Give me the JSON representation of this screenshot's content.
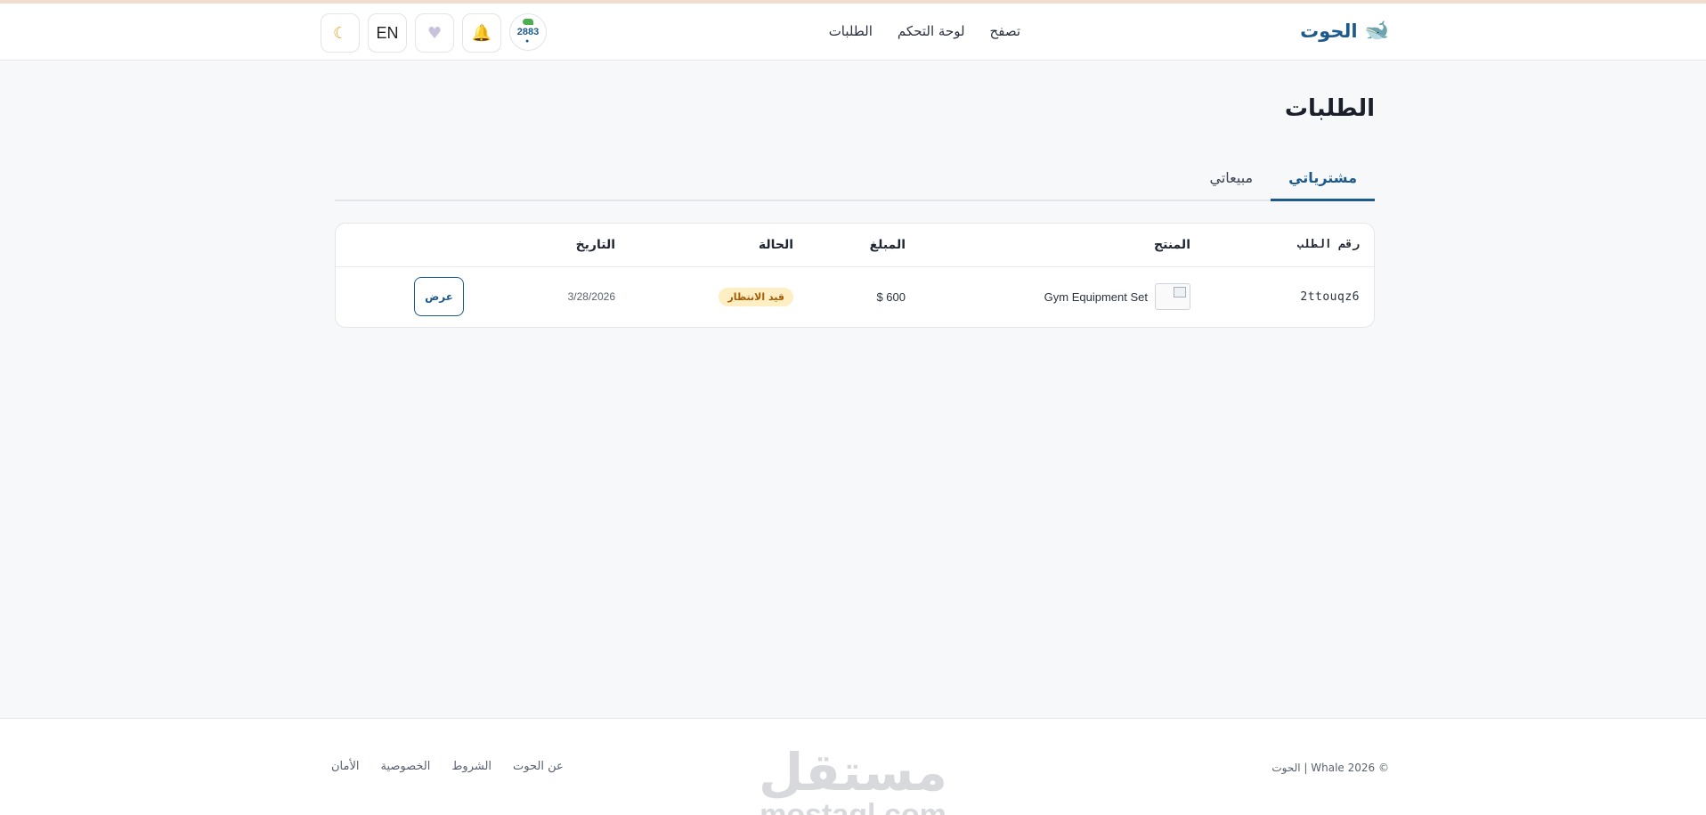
{
  "header": {
    "logo_text": "الحوت",
    "logo_icon": "whale-icon",
    "nav": [
      {
        "label": "تصفح"
      },
      {
        "label": "لوحة التحكم"
      },
      {
        "label": "الطلبات"
      }
    ],
    "actions": {
      "theme_icon": "moon-icon",
      "language_label": "EN",
      "favorites_icon": "heart-icon",
      "notifications_icon": "bell-icon",
      "avatar_text": "2883"
    }
  },
  "page": {
    "title": "الطلبات",
    "tabs": [
      {
        "label": "مشترياتي",
        "active": true
      },
      {
        "label": "مبيعاتي",
        "active": false
      }
    ]
  },
  "orders_table": {
    "columns": [
      "رقم الطلب",
      "المنتج",
      "المبلغ",
      "الحالة",
      "التاريخ",
      ""
    ],
    "rows": [
      {
        "order_id": "2ttouqz6",
        "product": "Gym Equipment Set",
        "amount": "$ 600",
        "status": "قيد الانتظار",
        "date": "3/28/2026",
        "action_label": "عرض"
      }
    ]
  },
  "footer": {
    "copyright": "© 2026 Whale | الحوت",
    "links": [
      {
        "label": "عن الحوت"
      },
      {
        "label": "الشروط"
      },
      {
        "label": "الخصوصية"
      },
      {
        "label": "الأمان"
      }
    ],
    "watermark_ar": "مستقل",
    "watermark_en": "mostaql.com"
  },
  "colors": {
    "brand": "#1c5a8c",
    "badge_bg": "#fdefc3",
    "badge_text": "#a45d07",
    "page_bg": "#f7f8fa"
  }
}
